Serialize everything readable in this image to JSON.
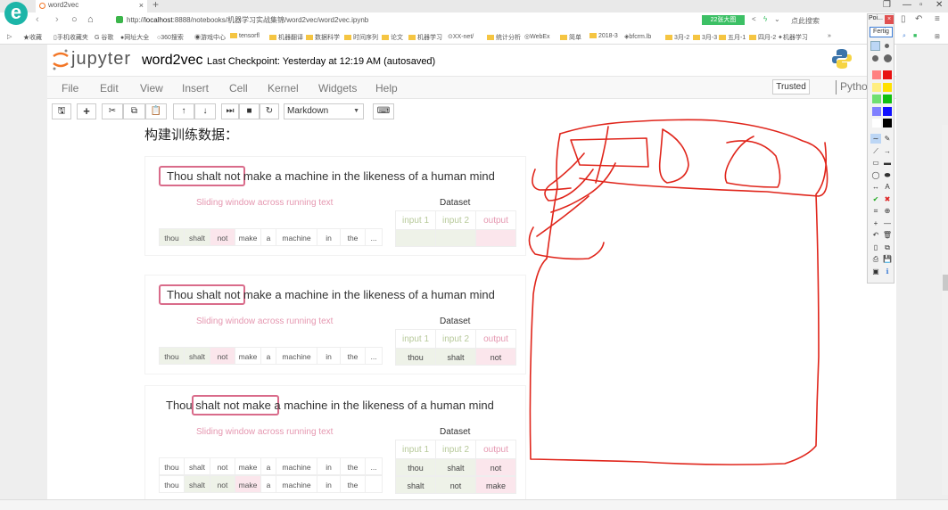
{
  "browser": {
    "tab_title": "word2vec",
    "tab_close": "×",
    "new_tab": "+",
    "url_prefix": "http://",
    "url_host": "localhost",
    "url_rest": ":8888/notebooks/机器学习实战集锦/word2vec/word2vec.ipynb",
    "green_badge": "22张大图",
    "search_placeholder": "点此搜索",
    "window_controls": {
      "restore": "❐",
      "minimize": "—",
      "maximize": "▫",
      "close": "✕"
    },
    "bookmarks": [
      "收藏",
      "手机收藏夹",
      "谷歌",
      "网址大全",
      "360搜索",
      "游戏中心",
      "tensorfl",
      "机器翻译",
      "数据科学",
      "时间序列",
      "论文",
      "机器学习",
      "XX-net/",
      "统计分析",
      "WebEx",
      "简单",
      "2018-3",
      "bfcrm.lb",
      "3月-2",
      "3月-3",
      "五月-1",
      "四月-2",
      "机器学习"
    ]
  },
  "jupyter": {
    "logo_text": "jupyter",
    "notebook_name": "word2vec",
    "checkpoint": "Last Checkpoint: Yesterday at 12:19 AM (autosaved)",
    "menu": [
      "File",
      "Edit",
      "View",
      "Insert",
      "Cell",
      "Kernel",
      "Widgets",
      "Help"
    ],
    "trusted": "Trusted",
    "kernel": "Python",
    "toolbar": {
      "buttons": [
        "save-icon",
        "plus-icon",
        "cut-icon",
        "copy-icon",
        "paste-icon",
        "arrow-up-icon",
        "arrow-down-icon",
        "step-forward-icon",
        "stop-icon",
        "restart-icon",
        "keyboard-icon"
      ],
      "cell_type": "Markdown"
    }
  },
  "content": {
    "heading": "构建训练数据：",
    "figures": [
      {
        "sentence_pre": "",
        "sentence_hl": "Thou shalt not",
        "sentence_post": " make a machine in the likeness of a human mind",
        "sliding_label": "Sliding window across running text",
        "dataset_label": "Dataset",
        "words": [
          [
            {
              "w": "thou",
              "c": "green"
            },
            {
              "w": "shalt",
              "c": "green"
            },
            {
              "w": "not",
              "c": "pink"
            },
            {
              "w": "make",
              "c": ""
            },
            {
              "w": "a",
              "c": ""
            },
            {
              "w": "machine",
              "c": ""
            },
            {
              "w": "in",
              "c": ""
            },
            {
              "w": "the",
              "c": ""
            },
            {
              "w": "...",
              "c": ""
            }
          ]
        ],
        "ds_headers": [
          "input 1",
          "input 2",
          "output"
        ],
        "ds_rows": [
          [
            "",
            "",
            ""
          ]
        ]
      },
      {
        "sentence_pre": "",
        "sentence_hl": "Thou shalt not",
        "sentence_post": " make a machine in the likeness of a human mind",
        "sliding_label": "Sliding window across running text",
        "dataset_label": "Dataset",
        "words": [
          [
            {
              "w": "thou",
              "c": "green"
            },
            {
              "w": "shalt",
              "c": "green"
            },
            {
              "w": "not",
              "c": "pink"
            },
            {
              "w": "make",
              "c": ""
            },
            {
              "w": "a",
              "c": ""
            },
            {
              "w": "machine",
              "c": ""
            },
            {
              "w": "in",
              "c": ""
            },
            {
              "w": "the",
              "c": ""
            },
            {
              "w": "...",
              "c": ""
            }
          ]
        ],
        "ds_headers": [
          "input 1",
          "input 2",
          "output"
        ],
        "ds_rows": [
          [
            "thou",
            "shalt",
            "not"
          ]
        ]
      },
      {
        "sentence_pre": "Thou ",
        "sentence_hl": "shalt not make",
        "sentence_post": " a machine in the likeness of a human mind",
        "sliding_label": "Sliding window across running text",
        "dataset_label": "Dataset",
        "words": [
          [
            {
              "w": "thou",
              "c": ""
            },
            {
              "w": "shalt",
              "c": ""
            },
            {
              "w": "not",
              "c": ""
            },
            {
              "w": "make",
              "c": ""
            },
            {
              "w": "a",
              "c": ""
            },
            {
              "w": "machine",
              "c": ""
            },
            {
              "w": "in",
              "c": ""
            },
            {
              "w": "the",
              "c": ""
            },
            {
              "w": "...",
              "c": ""
            }
          ],
          [
            {
              "w": "thou",
              "c": ""
            },
            {
              "w": "shalt",
              "c": "green"
            },
            {
              "w": "not",
              "c": "green"
            },
            {
              "w": "make",
              "c": "pink"
            },
            {
              "w": "a",
              "c": ""
            },
            {
              "w": "machine",
              "c": ""
            },
            {
              "w": "in",
              "c": ""
            },
            {
              "w": "the",
              "c": ""
            },
            {
              "w": "",
              "c": ""
            }
          ]
        ],
        "ds_headers": [
          "input 1",
          "input 2",
          "output"
        ],
        "ds_rows": [
          [
            "thou",
            "shalt",
            "not"
          ],
          [
            "shalt",
            "not",
            "make"
          ]
        ]
      }
    ]
  },
  "pointer_tool": {
    "title": "Poi...",
    "close": "×",
    "done_button": "Fertig",
    "colors": [
      "#ff8080",
      "#e81010",
      "#ffee80",
      "#ffe000",
      "#70e070",
      "#10c010",
      "#8080ff",
      "#1010ff",
      "#ffffff",
      "#000000"
    ],
    "tools": [
      "freehand-icon",
      "eraser-icon",
      "line-icon",
      "arrow-icon",
      "rect-icon",
      "filled-rect-icon",
      "ellipse-icon",
      "filled-ellipse-icon",
      "double-arrow-icon",
      "text-icon",
      "check-icon",
      "cross-icon",
      "crop-icon",
      "zoom-icon",
      "plus-icon",
      "minus-icon",
      "undo-icon",
      "trash-icon",
      "new-page-icon",
      "copy-icon",
      "print-icon",
      "save-icon",
      "screen-icon",
      "info-icon"
    ],
    "tool_glyphs": [
      "∼",
      "✎",
      "⟋",
      "→",
      "▭",
      "▬",
      "◯",
      "⬬",
      "↔",
      "A",
      "✔",
      "✖",
      "⌗",
      "⊕",
      "+",
      "—",
      "↶",
      "🗑",
      "▯",
      "⧉",
      "⎙",
      "💾",
      "▣",
      "ℹ"
    ]
  },
  "annotation": {
    "stroke_color": "#e0251b"
  }
}
